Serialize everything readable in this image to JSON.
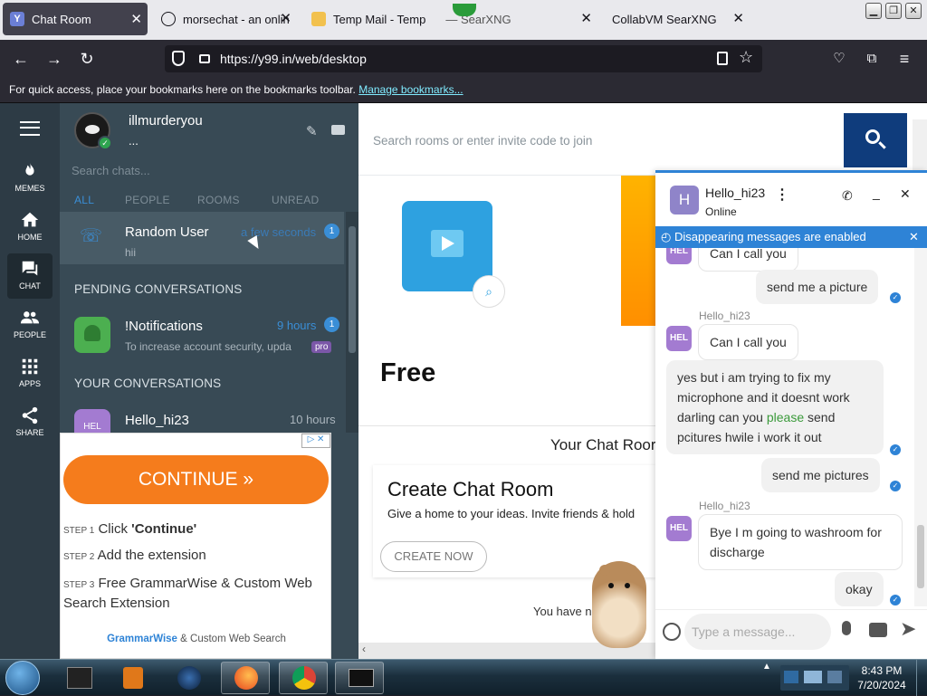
{
  "browser": {
    "tabs": [
      {
        "label": "Chat Room",
        "favicon": "Y",
        "active": true
      },
      {
        "label": "morsechat - an onlin",
        "favicon": "globe"
      },
      {
        "label": "Temp Mail - Temp",
        "favicon": "mail",
        "overlap": "— SearXNG"
      },
      {
        "label": "CollabVM SearXNG",
        "favicon": ""
      }
    ],
    "url": "https://y99.in/web/desktop",
    "bookmarks_text": "For quick access, place your bookmarks here on the bookmarks toolbar.",
    "bookmarks_link": "Manage bookmarks..."
  },
  "rail": [
    {
      "label": "MEMES",
      "icon": "fire-icon"
    },
    {
      "label": "HOME",
      "icon": "home-icon"
    },
    {
      "label": "CHAT",
      "icon": "chat-icon",
      "active": true
    },
    {
      "label": "PEOPLE",
      "icon": "people-icon"
    },
    {
      "label": "APPS",
      "icon": "apps-icon"
    },
    {
      "label": "SHARE",
      "icon": "share-icon"
    }
  ],
  "profile": {
    "name": "illmurderyou",
    "status": "..."
  },
  "chat_search_placeholder": "Search chats...",
  "filters": [
    "ALL",
    "PEOPLE",
    "ROOMS",
    "UNREAD"
  ],
  "conversations": {
    "active": {
      "name": "Random User",
      "preview": "hii",
      "time": "a few seconds",
      "badge": "1"
    },
    "pending_header": "PENDING CONVERSATIONS",
    "notifications": {
      "name": "!Notifications",
      "preview": "To increase account security, upda",
      "time": "9 hours",
      "badge": "1",
      "tag": "pro"
    },
    "yours_header": "YOUR CONVERSATIONS",
    "hello": {
      "name": "Hello_hi23",
      "avatar": "HEL",
      "time": "10 hours"
    }
  },
  "ad": {
    "continue_label": "CONTINUE",
    "steps": [
      {
        "n": "STEP 1",
        "text_a": "Click ",
        "text_b": "'Continue'"
      },
      {
        "n": "STEP 2",
        "text_a": "Add the extension",
        "text_b": ""
      },
      {
        "n": "STEP 3",
        "text_a": "Free GrammarWise & Custom Web Search Extension",
        "text_b": ""
      }
    ],
    "brand": "GrammarWise",
    "brand_suffix": "& Custom Web Search"
  },
  "main": {
    "search_placeholder": "Search rooms or enter invite code to join",
    "free_label": "Free",
    "your_chat_rooms": "Your Chat Roor",
    "create_title": "Create Chat Room",
    "create_desc": "Give a home to your ideas. Invite friends & hold",
    "create_button": "CREATE NOW",
    "you_have": "You have n"
  },
  "chat": {
    "contact": "Hello_hi23",
    "contact_initial": "H",
    "status": "Online",
    "notice": "Disappearing messages are enabled",
    "messages": [
      {
        "from": "them",
        "text": "Can I call you",
        "partial": true
      },
      {
        "from": "me",
        "text": "send me a picture"
      },
      {
        "from": "them",
        "sender": "Hello_hi23",
        "avatar": "HEL",
        "text": "Can I call you"
      },
      {
        "from": "me",
        "text_a": "yes but i am trying to fix my microphone and it doesnt work darling can you ",
        "highlight": "please",
        "text_b": " send pcitures hwile i work it out"
      },
      {
        "from": "me",
        "text": "send me pictures"
      },
      {
        "from": "them",
        "sender": "Hello_hi23",
        "avatar": "HEL",
        "text": "Bye I m going to washroom for discharge"
      },
      {
        "from": "me",
        "text": "okay"
      }
    ],
    "input_placeholder": "Type a message..."
  },
  "taskbar": {
    "time": "8:43 PM",
    "date": "7/20/2024"
  }
}
